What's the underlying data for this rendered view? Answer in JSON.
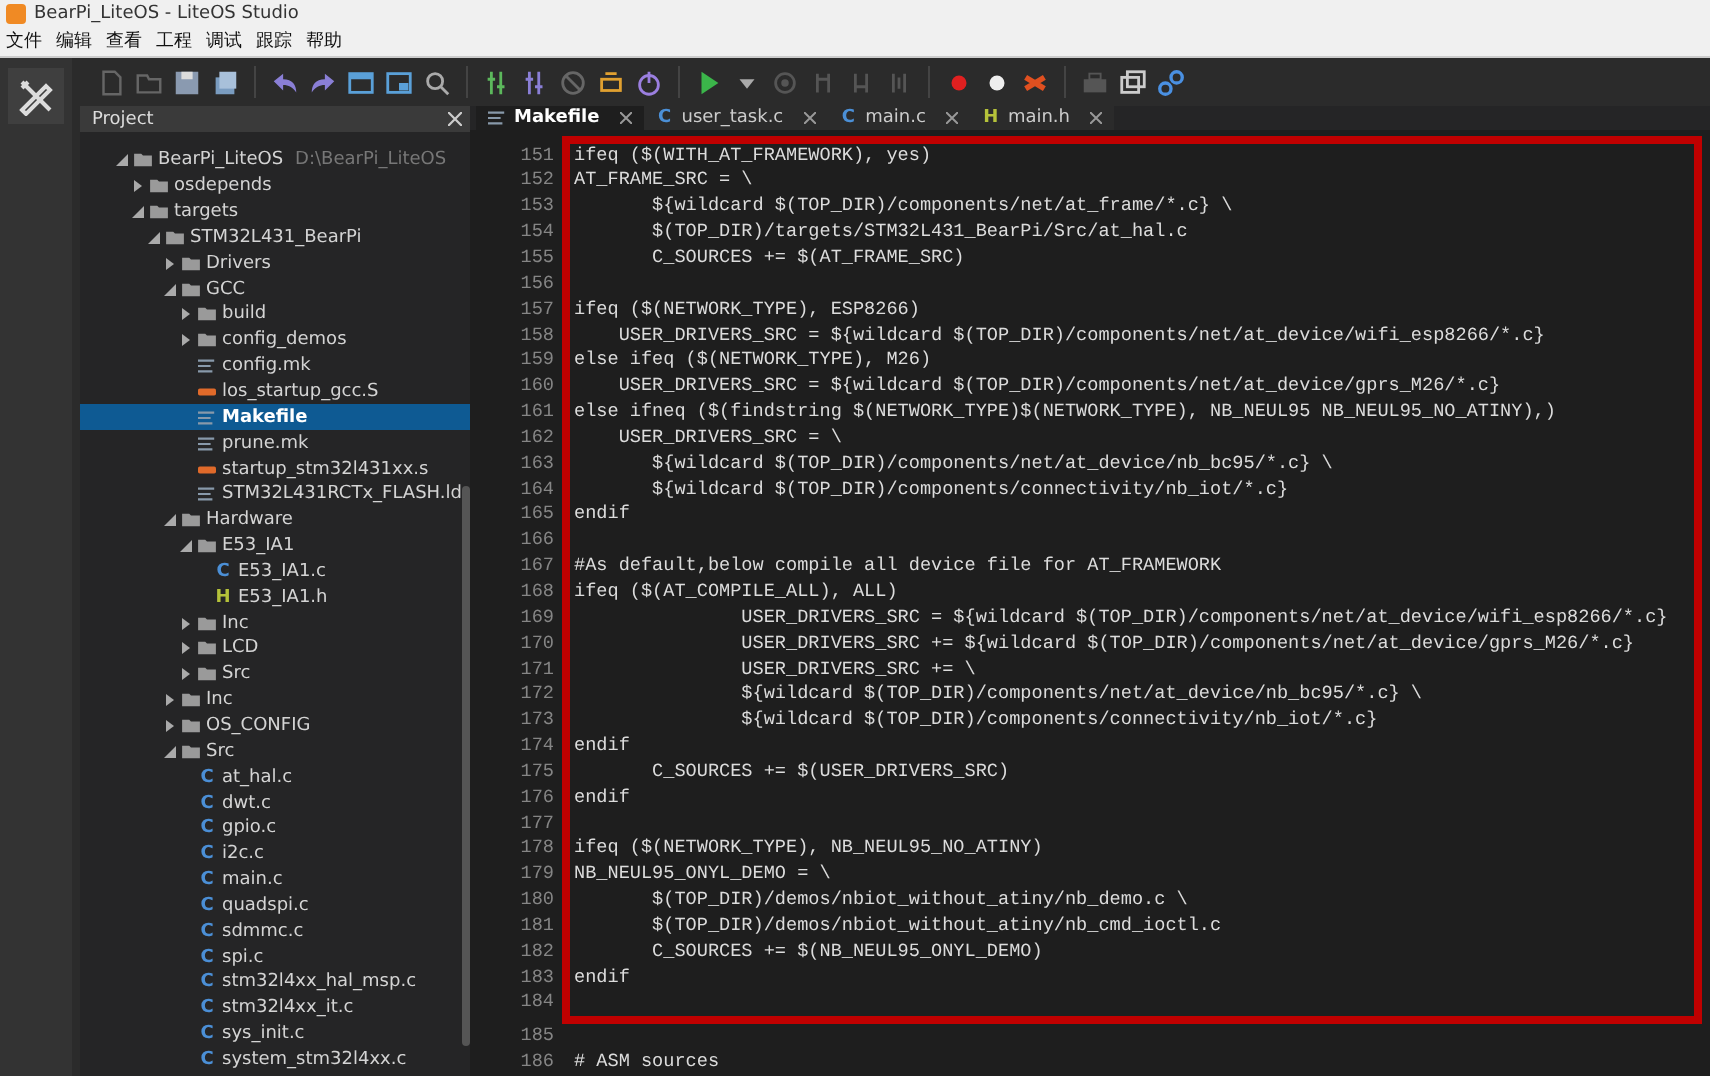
{
  "window": {
    "title": "BearPi_LiteOS - LiteOS Studio"
  },
  "menu": [
    "文件",
    "编辑",
    "查看",
    "工程",
    "调试",
    "跟踪",
    "帮助"
  ],
  "project_panel": {
    "title": "Project",
    "tree": [
      {
        "label": "BearPi_LiteOS",
        "path": "D:\\BearPi_LiteOS",
        "kind": "folder",
        "expanded": true,
        "selected": false,
        "children": [
          {
            "label": "osdepends",
            "kind": "folder",
            "expanded": false,
            "selected": false
          },
          {
            "label": "targets",
            "kind": "folder",
            "expanded": true,
            "selected": false,
            "children": [
              {
                "label": "STM32L431_BearPi",
                "kind": "folder",
                "expanded": true,
                "selected": false,
                "children": [
                  {
                    "label": "Drivers",
                    "kind": "folder",
                    "expanded": false,
                    "selected": false
                  },
                  {
                    "label": "GCC",
                    "kind": "folder",
                    "expanded": true,
                    "selected": false,
                    "children": [
                      {
                        "label": "build",
                        "kind": "folder",
                        "expanded": false,
                        "selected": false
                      },
                      {
                        "label": "config_demos",
                        "kind": "folder",
                        "expanded": false,
                        "selected": false
                      },
                      {
                        "label": "config.mk",
                        "kind": "make",
                        "selected": false
                      },
                      {
                        "label": "los_startup_gcc.S",
                        "kind": "asm",
                        "selected": false
                      },
                      {
                        "label": "Makefile",
                        "kind": "make",
                        "selected": true
                      },
                      {
                        "label": "prune.mk",
                        "kind": "make",
                        "selected": false
                      },
                      {
                        "label": "startup_stm32l431xx.s",
                        "kind": "asm",
                        "selected": false
                      },
                      {
                        "label": "STM32L431RCTx_FLASH.ld",
                        "kind": "make",
                        "selected": false
                      }
                    ]
                  },
                  {
                    "label": "Hardware",
                    "kind": "folder",
                    "expanded": true,
                    "selected": false,
                    "children": [
                      {
                        "label": "E53_IA1",
                        "kind": "folder",
                        "expanded": true,
                        "selected": false,
                        "children": [
                          {
                            "label": "E53_IA1.c",
                            "kind": "c",
                            "icon": "C",
                            "selected": false
                          },
                          {
                            "label": "E53_IA1.h",
                            "kind": "h",
                            "icon": "H",
                            "selected": false
                          }
                        ]
                      },
                      {
                        "label": "Inc",
                        "kind": "folder",
                        "expanded": false,
                        "selected": false
                      },
                      {
                        "label": "LCD",
                        "kind": "folder",
                        "expanded": false,
                        "selected": false
                      },
                      {
                        "label": "Src",
                        "kind": "folder",
                        "expanded": false,
                        "selected": false
                      }
                    ]
                  },
                  {
                    "label": "Inc",
                    "kind": "folder",
                    "expanded": false,
                    "selected": false
                  },
                  {
                    "label": "OS_CONFIG",
                    "kind": "folder",
                    "expanded": false,
                    "selected": false
                  },
                  {
                    "label": "Src",
                    "kind": "folder",
                    "expanded": true,
                    "selected": false,
                    "children": [
                      {
                        "label": "at_hal.c",
                        "kind": "c",
                        "icon": "C",
                        "selected": false
                      },
                      {
                        "label": "dwt.c",
                        "kind": "c",
                        "icon": "C",
                        "selected": false
                      },
                      {
                        "label": "gpio.c",
                        "kind": "c",
                        "icon": "C",
                        "selected": false
                      },
                      {
                        "label": "i2c.c",
                        "kind": "c",
                        "icon": "C",
                        "selected": false
                      },
                      {
                        "label": "main.c",
                        "kind": "c",
                        "icon": "C",
                        "selected": false
                      },
                      {
                        "label": "quadspi.c",
                        "kind": "c",
                        "icon": "C",
                        "selected": false
                      },
                      {
                        "label": "sdmmc.c",
                        "kind": "c",
                        "icon": "C",
                        "selected": false
                      },
                      {
                        "label": "spi.c",
                        "kind": "c",
                        "icon": "C",
                        "selected": false
                      },
                      {
                        "label": "stm32l4xx_hal_msp.c",
                        "kind": "c",
                        "icon": "C",
                        "selected": false
                      },
                      {
                        "label": "stm32l4xx_it.c",
                        "kind": "c",
                        "icon": "C",
                        "selected": false
                      },
                      {
                        "label": "sys_init.c",
                        "kind": "c",
                        "icon": "C",
                        "selected": false
                      },
                      {
                        "label": "system_stm32l4xx.c",
                        "kind": "c",
                        "icon": "C",
                        "selected": false
                      }
                    ]
                  }
                ]
              }
            ]
          }
        ]
      }
    ]
  },
  "tabs": [
    {
      "label": "Makefile",
      "kind": "make",
      "selected": true
    },
    {
      "label": "user_task.c",
      "kind": "c",
      "icon": "C",
      "selected": false
    },
    {
      "label": "main.c",
      "kind": "c",
      "icon": "C",
      "selected": false
    },
    {
      "label": "main.h",
      "kind": "h",
      "icon": "H",
      "selected": false
    }
  ],
  "editor": {
    "framed_lines": [
      {
        "number": "151",
        "text": "ifeq ($(WITH_AT_FRAMEWORK), yes)"
      },
      {
        "number": "152",
        "text": "AT_FRAME_SRC = \\"
      },
      {
        "number": "153",
        "text": "       ${wildcard $(TOP_DIR)/components/net/at_frame/*.c} \\"
      },
      {
        "number": "154",
        "text": "       $(TOP_DIR)/targets/STM32L431_BearPi/Src/at_hal.c"
      },
      {
        "number": "155",
        "text": "       C_SOURCES += $(AT_FRAME_SRC)"
      },
      {
        "number": "156"
      },
      {
        "number": "157",
        "text": "ifeq ($(NETWORK_TYPE), ESP8266)"
      },
      {
        "number": "158",
        "text": "    USER_DRIVERS_SRC = ${wildcard $(TOP_DIR)/components/net/at_device/wifi_esp8266/*.c}"
      },
      {
        "number": "159",
        "text": "else ifeq ($(NETWORK_TYPE), M26)"
      },
      {
        "number": "160",
        "text": "    USER_DRIVERS_SRC = ${wildcard $(TOP_DIR)/components/net/at_device/gprs_M26/*.c}"
      },
      {
        "number": "161",
        "text": "else ifneq ($(findstring $(NETWORK_TYPE)$(NETWORK_TYPE), NB_NEUL95 NB_NEUL95_NO_ATINY),)"
      },
      {
        "number": "162",
        "text": "    USER_DRIVERS_SRC = \\"
      },
      {
        "number": "163",
        "text": "       ${wildcard $(TOP_DIR)/components/net/at_device/nb_bc95/*.c} \\"
      },
      {
        "number": "164",
        "text": "       ${wildcard $(TOP_DIR)/components/connectivity/nb_iot/*.c}"
      },
      {
        "number": "165",
        "text": "endif"
      },
      {
        "number": "166"
      },
      {
        "number": "167",
        "text": "#As default,below compile all device file for AT_FRAMEWORK"
      },
      {
        "number": "168",
        "text": "ifeq ($(AT_COMPILE_ALL), ALL)"
      },
      {
        "number": "169",
        "text": "               USER_DRIVERS_SRC = ${wildcard $(TOP_DIR)/components/net/at_device/wifi_esp8266/*.c}"
      },
      {
        "number": "170",
        "text": "               USER_DRIVERS_SRC += ${wildcard $(TOP_DIR)/components/net/at_device/gprs_M26/*.c}"
      },
      {
        "number": "171",
        "text": "               USER_DRIVERS_SRC += \\"
      },
      {
        "number": "172",
        "text": "               ${wildcard $(TOP_DIR)/components/net/at_device/nb_bc95/*.c} \\"
      },
      {
        "number": "173",
        "text": "               ${wildcard $(TOP_DIR)/components/connectivity/nb_iot/*.c}"
      },
      {
        "number": "174",
        "text": "endif"
      },
      {
        "number": "175",
        "text": "       C_SOURCES += $(USER_DRIVERS_SRC)"
      },
      {
        "number": "176",
        "text": "endif"
      },
      {
        "number": "177"
      },
      {
        "number": "178",
        "text": "ifeq ($(NETWORK_TYPE), NB_NEUL95_NO_ATINY)"
      },
      {
        "number": "179",
        "text": "NB_NEUL95_ONYL_DEMO = \\"
      },
      {
        "number": "180",
        "text": "       $(TOP_DIR)/demos/nbiot_without_atiny/nb_demo.c \\"
      },
      {
        "number": "181",
        "text": "       $(TOP_DIR)/demos/nbiot_without_atiny/nb_cmd_ioctl.c"
      },
      {
        "number": "182",
        "text": "       C_SOURCES += $(NB_NEUL95_ONYL_DEMO)"
      },
      {
        "number": "183",
        "text": "endif"
      },
      {
        "number": "184"
      }
    ],
    "lines": [
      {
        "number": "185"
      },
      {
        "number": "186",
        "text": "# ASM sources"
      }
    ]
  }
}
